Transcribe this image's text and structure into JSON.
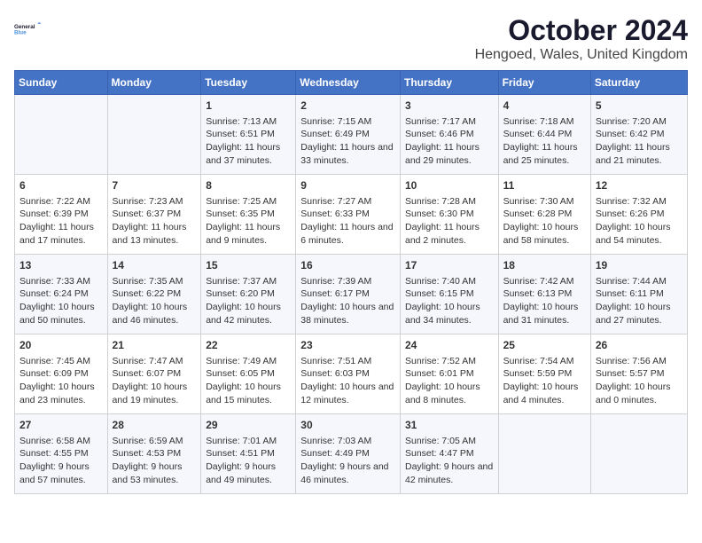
{
  "logo": {
    "line1": "General",
    "line2": "Blue"
  },
  "title": "October 2024",
  "subtitle": "Hengoed, Wales, United Kingdom",
  "days_of_week": [
    "Sunday",
    "Monday",
    "Tuesday",
    "Wednesday",
    "Thursday",
    "Friday",
    "Saturday"
  ],
  "weeks": [
    [
      {
        "day": "",
        "content": ""
      },
      {
        "day": "",
        "content": ""
      },
      {
        "day": "1",
        "content": "Sunrise: 7:13 AM\nSunset: 6:51 PM\nDaylight: 11 hours and 37 minutes."
      },
      {
        "day": "2",
        "content": "Sunrise: 7:15 AM\nSunset: 6:49 PM\nDaylight: 11 hours and 33 minutes."
      },
      {
        "day": "3",
        "content": "Sunrise: 7:17 AM\nSunset: 6:46 PM\nDaylight: 11 hours and 29 minutes."
      },
      {
        "day": "4",
        "content": "Sunrise: 7:18 AM\nSunset: 6:44 PM\nDaylight: 11 hours and 25 minutes."
      },
      {
        "day": "5",
        "content": "Sunrise: 7:20 AM\nSunset: 6:42 PM\nDaylight: 11 hours and 21 minutes."
      }
    ],
    [
      {
        "day": "6",
        "content": "Sunrise: 7:22 AM\nSunset: 6:39 PM\nDaylight: 11 hours and 17 minutes."
      },
      {
        "day": "7",
        "content": "Sunrise: 7:23 AM\nSunset: 6:37 PM\nDaylight: 11 hours and 13 minutes."
      },
      {
        "day": "8",
        "content": "Sunrise: 7:25 AM\nSunset: 6:35 PM\nDaylight: 11 hours and 9 minutes."
      },
      {
        "day": "9",
        "content": "Sunrise: 7:27 AM\nSunset: 6:33 PM\nDaylight: 11 hours and 6 minutes."
      },
      {
        "day": "10",
        "content": "Sunrise: 7:28 AM\nSunset: 6:30 PM\nDaylight: 11 hours and 2 minutes."
      },
      {
        "day": "11",
        "content": "Sunrise: 7:30 AM\nSunset: 6:28 PM\nDaylight: 10 hours and 58 minutes."
      },
      {
        "day": "12",
        "content": "Sunrise: 7:32 AM\nSunset: 6:26 PM\nDaylight: 10 hours and 54 minutes."
      }
    ],
    [
      {
        "day": "13",
        "content": "Sunrise: 7:33 AM\nSunset: 6:24 PM\nDaylight: 10 hours and 50 minutes."
      },
      {
        "day": "14",
        "content": "Sunrise: 7:35 AM\nSunset: 6:22 PM\nDaylight: 10 hours and 46 minutes."
      },
      {
        "day": "15",
        "content": "Sunrise: 7:37 AM\nSunset: 6:20 PM\nDaylight: 10 hours and 42 minutes."
      },
      {
        "day": "16",
        "content": "Sunrise: 7:39 AM\nSunset: 6:17 PM\nDaylight: 10 hours and 38 minutes."
      },
      {
        "day": "17",
        "content": "Sunrise: 7:40 AM\nSunset: 6:15 PM\nDaylight: 10 hours and 34 minutes."
      },
      {
        "day": "18",
        "content": "Sunrise: 7:42 AM\nSunset: 6:13 PM\nDaylight: 10 hours and 31 minutes."
      },
      {
        "day": "19",
        "content": "Sunrise: 7:44 AM\nSunset: 6:11 PM\nDaylight: 10 hours and 27 minutes."
      }
    ],
    [
      {
        "day": "20",
        "content": "Sunrise: 7:45 AM\nSunset: 6:09 PM\nDaylight: 10 hours and 23 minutes."
      },
      {
        "day": "21",
        "content": "Sunrise: 7:47 AM\nSunset: 6:07 PM\nDaylight: 10 hours and 19 minutes."
      },
      {
        "day": "22",
        "content": "Sunrise: 7:49 AM\nSunset: 6:05 PM\nDaylight: 10 hours and 15 minutes."
      },
      {
        "day": "23",
        "content": "Sunrise: 7:51 AM\nSunset: 6:03 PM\nDaylight: 10 hours and 12 minutes."
      },
      {
        "day": "24",
        "content": "Sunrise: 7:52 AM\nSunset: 6:01 PM\nDaylight: 10 hours and 8 minutes."
      },
      {
        "day": "25",
        "content": "Sunrise: 7:54 AM\nSunset: 5:59 PM\nDaylight: 10 hours and 4 minutes."
      },
      {
        "day": "26",
        "content": "Sunrise: 7:56 AM\nSunset: 5:57 PM\nDaylight: 10 hours and 0 minutes."
      }
    ],
    [
      {
        "day": "27",
        "content": "Sunrise: 6:58 AM\nSunset: 4:55 PM\nDaylight: 9 hours and 57 minutes."
      },
      {
        "day": "28",
        "content": "Sunrise: 6:59 AM\nSunset: 4:53 PM\nDaylight: 9 hours and 53 minutes."
      },
      {
        "day": "29",
        "content": "Sunrise: 7:01 AM\nSunset: 4:51 PM\nDaylight: 9 hours and 49 minutes."
      },
      {
        "day": "30",
        "content": "Sunrise: 7:03 AM\nSunset: 4:49 PM\nDaylight: 9 hours and 46 minutes."
      },
      {
        "day": "31",
        "content": "Sunrise: 7:05 AM\nSunset: 4:47 PM\nDaylight: 9 hours and 42 minutes."
      },
      {
        "day": "",
        "content": ""
      },
      {
        "day": "",
        "content": ""
      }
    ]
  ]
}
